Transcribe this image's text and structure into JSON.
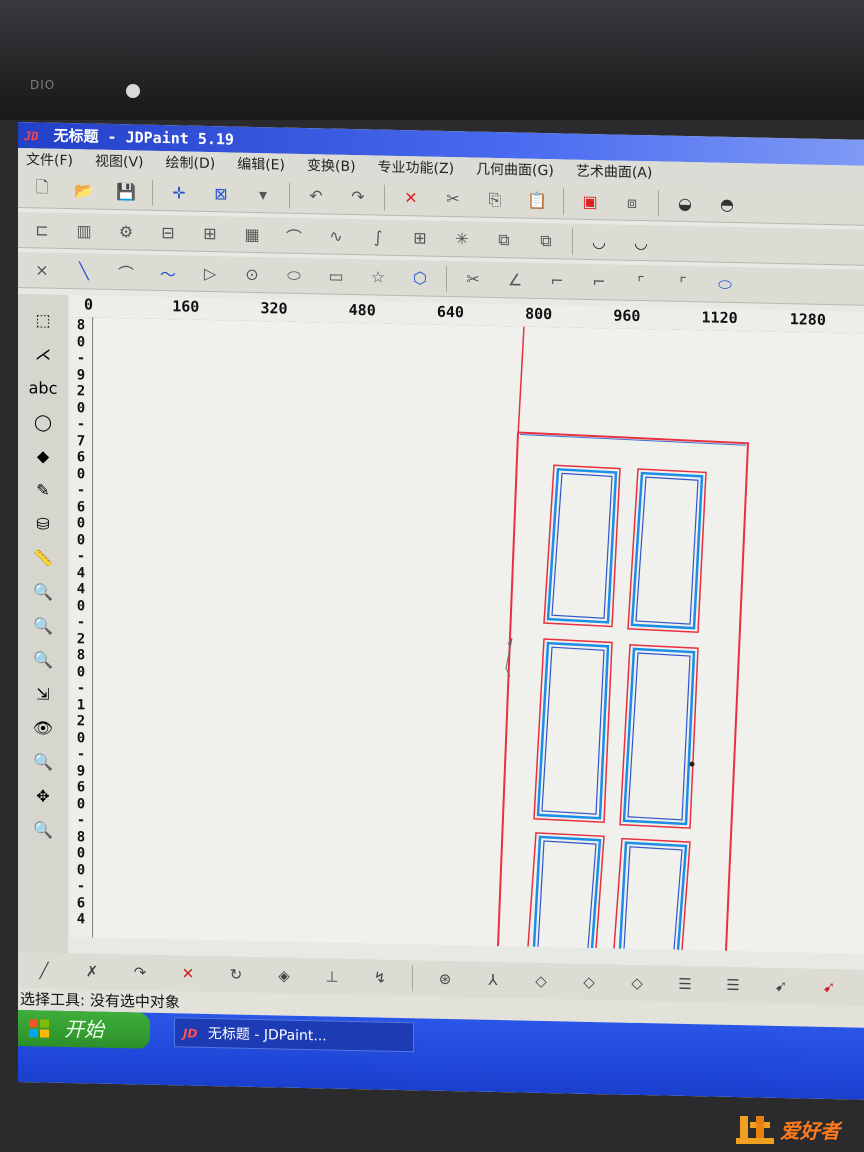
{
  "bezel": {
    "label": "DIO"
  },
  "window": {
    "logo": "JD",
    "title": "无标题 - JDPaint 5.19"
  },
  "menu": [
    "文件(F)",
    "视图(V)",
    "绘制(D)",
    "编辑(E)",
    "变换(B)",
    "专业功能(Z)",
    "几何曲面(G)",
    "艺术曲面(A)"
  ],
  "toolbar1": [
    {
      "name": "new-file-icon",
      "glyph": "🗋"
    },
    {
      "name": "open-folder-icon",
      "glyph": "📂"
    },
    {
      "name": "save-icon",
      "glyph": "💾"
    },
    {
      "name": "crosshair-select-icon",
      "glyph": "✛"
    },
    {
      "name": "box-select-icon",
      "glyph": "⊠"
    },
    {
      "name": "dropdown-arrow-icon",
      "glyph": "▾"
    },
    {
      "name": "undo-icon",
      "glyph": "↶"
    },
    {
      "name": "redo-icon",
      "glyph": "↷"
    },
    {
      "name": "delete-icon",
      "glyph": "✕"
    },
    {
      "name": "cut-icon",
      "glyph": "✂"
    },
    {
      "name": "copy-icon",
      "glyph": "⎘"
    },
    {
      "name": "paste-icon",
      "glyph": "📋"
    },
    {
      "name": "layer-view-icon",
      "glyph": "▣"
    },
    {
      "name": "cube-view-icon",
      "glyph": "⧈"
    },
    {
      "name": "dome-view-icon",
      "glyph": "◒"
    },
    {
      "name": "dome-dark-view-icon",
      "glyph": "◓"
    }
  ],
  "toolbar2": [
    {
      "name": "align-left-icon",
      "glyph": "⊏"
    },
    {
      "name": "align-grid-icon",
      "glyph": "▥"
    },
    {
      "name": "gear-shape-icon",
      "glyph": "⚙"
    },
    {
      "name": "frame-icon",
      "glyph": "⊟"
    },
    {
      "name": "frame-double-icon",
      "glyph": "⊞"
    },
    {
      "name": "hatch-icon",
      "glyph": "▦"
    },
    {
      "name": "curve-points-icon",
      "glyph": "⌒"
    },
    {
      "name": "wave-icon",
      "glyph": "∿"
    },
    {
      "name": "spiral-icon",
      "glyph": "∫"
    },
    {
      "name": "grid-box-icon",
      "glyph": "⊞"
    },
    {
      "name": "star-grid-icon",
      "glyph": "✳"
    },
    {
      "name": "copy-frame-icon",
      "glyph": "⧉"
    },
    {
      "name": "duplicate-icon",
      "glyph": "⧉"
    },
    {
      "name": "bowl-icon",
      "glyph": "◡"
    },
    {
      "name": "bowl-dark-icon",
      "glyph": "◡"
    }
  ],
  "toolbar3": [
    {
      "name": "point-icon",
      "glyph": "×"
    },
    {
      "name": "line-icon",
      "glyph": "╲"
    },
    {
      "name": "arc-icon",
      "glyph": "⌒"
    },
    {
      "name": "polyline-icon",
      "glyph": "〜"
    },
    {
      "name": "triangle-icon",
      "glyph": "▷"
    },
    {
      "name": "circle-icon",
      "glyph": "⊙"
    },
    {
      "name": "ellipse-icon",
      "glyph": "⬭"
    },
    {
      "name": "rectangle-icon",
      "glyph": "▭"
    },
    {
      "name": "star-icon",
      "glyph": "☆"
    },
    {
      "name": "polygon-icon",
      "glyph": "⬡"
    },
    {
      "name": "scissors-icon",
      "glyph": "✂"
    },
    {
      "name": "angle-icon",
      "glyph": "∠"
    },
    {
      "name": "corner-icon",
      "glyph": "⌐"
    },
    {
      "name": "chamfer-icon",
      "glyph": "⌐"
    },
    {
      "name": "fillet-icon",
      "glyph": "⌜"
    },
    {
      "name": "offset-icon",
      "glyph": "⌜"
    },
    {
      "name": "slot-icon",
      "glyph": "⬭"
    }
  ],
  "hruler": [
    "0",
    "160",
    "320",
    "480",
    "640",
    "800",
    "960",
    "1120",
    "1280"
  ],
  "vruler": [
    "8",
    "0",
    "-",
    "9",
    "2",
    "0",
    "-",
    "7",
    "6",
    "0",
    "-",
    "6",
    "0",
    "0",
    "-",
    "4",
    "4",
    "0",
    "-",
    "2",
    "8",
    "0",
    "-",
    "1",
    "2",
    "0",
    "-",
    "9",
    "6",
    "0",
    "-",
    "8",
    "0",
    "0",
    "-",
    "6",
    "4"
  ],
  "lefttools": [
    {
      "name": "marquee-icon",
      "glyph": "⬚"
    },
    {
      "name": "node-edit-icon",
      "glyph": "⋌"
    },
    {
      "name": "text-abc-icon",
      "glyph": "abc"
    },
    {
      "name": "shape-circle-icon",
      "glyph": "◯"
    },
    {
      "name": "fill-icon",
      "glyph": "◆"
    },
    {
      "name": "pen-icon",
      "glyph": "✎"
    },
    {
      "name": "bucket-icon",
      "glyph": "⛁"
    },
    {
      "name": "measure-icon",
      "glyph": "📏"
    },
    {
      "name": "zoom-window-icon",
      "glyph": "🔍"
    },
    {
      "name": "zoom-out-icon",
      "glyph": "🔍"
    },
    {
      "name": "zoom-in-icon",
      "glyph": "🔍"
    },
    {
      "name": "zoom-all-icon",
      "glyph": "⇲"
    },
    {
      "name": "eye-icon",
      "glyph": "👁"
    },
    {
      "name": "zoom-prev-icon",
      "glyph": "🔍"
    },
    {
      "name": "pan-icon",
      "glyph": "✥"
    },
    {
      "name": "zoom-real-icon",
      "glyph": "🔍"
    }
  ],
  "bottomtools": [
    {
      "name": "line-tool-icon",
      "glyph": "╱"
    },
    {
      "name": "trim-icon",
      "glyph": "✗"
    },
    {
      "name": "extend-icon",
      "glyph": "↷"
    },
    {
      "name": "cross-icon",
      "glyph": "✕"
    },
    {
      "name": "rotate-icon",
      "glyph": "↻"
    },
    {
      "name": "diamond-icon",
      "glyph": "◈"
    },
    {
      "name": "perpendicular-icon",
      "glyph": "⊥"
    },
    {
      "name": "break-icon",
      "glyph": "↯"
    },
    {
      "name": "join-icon",
      "glyph": "⊛"
    },
    {
      "name": "axis-icon",
      "glyph": "⅄"
    },
    {
      "name": "iso-view-icon",
      "glyph": "◇"
    },
    {
      "name": "iso-view2-icon",
      "glyph": "◇"
    },
    {
      "name": "iso-view3-icon",
      "glyph": "◇"
    },
    {
      "name": "layer-stack-icon",
      "glyph": "☰"
    },
    {
      "name": "layer-stack2-icon",
      "glyph": "☰"
    },
    {
      "name": "pointer-plus-icon",
      "glyph": "➹"
    },
    {
      "name": "pointer-x-icon",
      "glyph": "➹"
    }
  ],
  "status": {
    "text": "选择工具: 没有选中对象"
  },
  "taskbar": {
    "start_label": "开始",
    "item_logo": "JD",
    "item_label": "无标题 - JDPaint..."
  },
  "watermark": {
    "text": "爱好者"
  },
  "colors": {
    "outline_red": "#e83040",
    "inner_blue": "#1a8ee8",
    "titlebar": "#2f4fdc"
  }
}
